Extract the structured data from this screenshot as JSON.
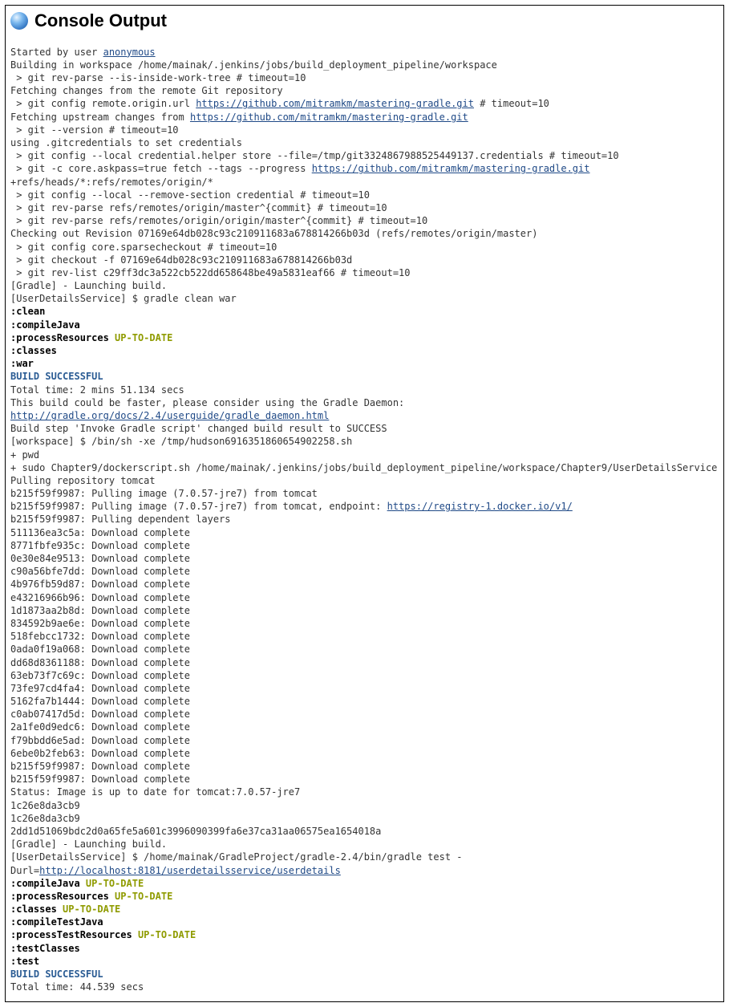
{
  "header": {
    "title": "Console Output"
  },
  "lines": [
    [
      {
        "t": "Started by user "
      },
      {
        "t": "anonymous",
        "link": true
      }
    ],
    [
      {
        "t": "Building in workspace /home/mainak/.jenkins/jobs/build_deployment_pipeline/workspace"
      }
    ],
    [
      {
        "t": " > git rev-parse --is-inside-work-tree # timeout=10"
      }
    ],
    [
      {
        "t": "Fetching changes from the remote Git repository"
      }
    ],
    [
      {
        "t": " > git config remote.origin.url "
      },
      {
        "t": "https://github.com/mitramkm/mastering-gradle.git",
        "link": true
      },
      {
        "t": " # timeout=10"
      }
    ],
    [
      {
        "t": "Fetching upstream changes from "
      },
      {
        "t": "https://github.com/mitramkm/mastering-gradle.git",
        "link": true
      }
    ],
    [
      {
        "t": " > git --version # timeout=10"
      }
    ],
    [
      {
        "t": "using .gitcredentials to set credentials"
      }
    ],
    [
      {
        "t": " > git config --local credential.helper store --file=/tmp/git3324867988525449137.credentials # timeout=10"
      }
    ],
    [
      {
        "t": " > git -c core.askpass=true fetch --tags --progress "
      },
      {
        "t": "https://github.com/mitramkm/mastering-gradle.git",
        "link": true
      },
      {
        "t": " +refs/heads/*:refs/remotes/origin/*"
      }
    ],
    [
      {
        "t": " > git config --local --remove-section credential # timeout=10"
      }
    ],
    [
      {
        "t": " > git rev-parse refs/remotes/origin/master^{commit} # timeout=10"
      }
    ],
    [
      {
        "t": " > git rev-parse refs/remotes/origin/origin/master^{commit} # timeout=10"
      }
    ],
    [
      {
        "t": "Checking out Revision 07169e64db028c93c210911683a678814266b03d (refs/remotes/origin/master)"
      }
    ],
    [
      {
        "t": " > git config core.sparsecheckout # timeout=10"
      }
    ],
    [
      {
        "t": " > git checkout -f 07169e64db028c93c210911683a678814266b03d"
      }
    ],
    [
      {
        "t": " > git rev-list c29ff3dc3a522cb522dd658648be49a5831eaf66 # timeout=10"
      }
    ],
    [
      {
        "t": "[Gradle] - Launching build."
      }
    ],
    [
      {
        "t": "[UserDetailsService] $ gradle clean war"
      }
    ],
    [
      {
        "t": ":clean",
        "cls": "bold"
      }
    ],
    [
      {
        "t": ":compileJava",
        "cls": "bold"
      }
    ],
    [
      {
        "t": ":processResources",
        "cls": "bold"
      },
      {
        "t": " UP-TO-DATE",
        "cls": "olive"
      }
    ],
    [
      {
        "t": ":classes",
        "cls": "bold"
      }
    ],
    [
      {
        "t": ":war",
        "cls": "bold"
      }
    ],
    [
      {
        "t": ""
      }
    ],
    [
      {
        "t": "BUILD SUCCESSFUL",
        "cls": "navy"
      }
    ],
    [
      {
        "t": ""
      }
    ],
    [
      {
        "t": "Total time: 2 mins 51.134 secs"
      }
    ],
    [
      {
        "t": ""
      }
    ],
    [
      {
        "t": "This build could be faster, please consider using the Gradle Daemon: "
      },
      {
        "t": "http://gradle.org/docs/2.4/userguide/gradle_daemon.html",
        "link": true
      }
    ],
    [
      {
        "t": "Build step 'Invoke Gradle script' changed build result to SUCCESS"
      }
    ],
    [
      {
        "t": "[workspace] $ /bin/sh -xe /tmp/hudson6916351860654902258.sh"
      }
    ],
    [
      {
        "t": "+ pwd"
      }
    ],
    [
      {
        "t": "+ sudo Chapter9/dockerscript.sh /home/mainak/.jenkins/jobs/build_deployment_pipeline/workspace/Chapter9/UserDetailsService"
      }
    ],
    [
      {
        "t": "Pulling repository tomcat"
      }
    ],
    [
      {
        "t": "b215f59f9987: Pulling image (7.0.57-jre7) from tomcat"
      }
    ],
    [
      {
        "t": "b215f59f9987: Pulling image (7.0.57-jre7) from tomcat, endpoint: "
      },
      {
        "t": "https://registry-1.docker.io/v1/",
        "link": true
      }
    ],
    [
      {
        "t": "b215f59f9987: Pulling dependent layers"
      }
    ],
    [
      {
        "t": "511136ea3c5a: Download complete"
      }
    ],
    [
      {
        "t": "8771fbfe935c: Download complete"
      }
    ],
    [
      {
        "t": "0e30e84e9513: Download complete"
      }
    ],
    [
      {
        "t": "c90a56bfe7dd: Download complete"
      }
    ],
    [
      {
        "t": "4b976fb59d87: Download complete"
      }
    ],
    [
      {
        "t": "e43216966b96: Download complete"
      }
    ],
    [
      {
        "t": "1d1873aa2b8d: Download complete"
      }
    ],
    [
      {
        "t": "834592b9ae6e: Download complete"
      }
    ],
    [
      {
        "t": "518febcc1732: Download complete"
      }
    ],
    [
      {
        "t": "0ada0f19a068: Download complete"
      }
    ],
    [
      {
        "t": "dd68d8361188: Download complete"
      }
    ],
    [
      {
        "t": "63eb73f7c69c: Download complete"
      }
    ],
    [
      {
        "t": "73fe97cd4fa4: Download complete"
      }
    ],
    [
      {
        "t": "5162fa7b1444: Download complete"
      }
    ],
    [
      {
        "t": "c0ab07417d5d: Download complete"
      }
    ],
    [
      {
        "t": "2a1fe0d9edc6: Download complete"
      }
    ],
    [
      {
        "t": "f79bbdd6e5ad: Download complete"
      }
    ],
    [
      {
        "t": "6ebe0b2feb63: Download complete"
      }
    ],
    [
      {
        "t": "b215f59f9987: Download complete"
      }
    ],
    [
      {
        "t": "b215f59f9987: Download complete"
      }
    ],
    [
      {
        "t": "Status: Image is up to date for tomcat:7.0.57-jre7"
      }
    ],
    [
      {
        "t": "1c26e8da3cb9"
      }
    ],
    [
      {
        "t": "1c26e8da3cb9"
      }
    ],
    [
      {
        "t": "2dd1d51069bdc2d0a65fe5a601c3996090399fa6e37ca31aa06575ea1654018a"
      }
    ],
    [
      {
        "t": "[Gradle] - Launching build."
      }
    ],
    [
      {
        "t": "[UserDetailsService] $ /home/mainak/GradleProject/gradle-2.4/bin/gradle test -Durl="
      },
      {
        "t": "http://localhost:8181/userdetailsservice/userdetails",
        "link": true
      }
    ],
    [
      {
        "t": ":compileJava",
        "cls": "bold"
      },
      {
        "t": " UP-TO-DATE",
        "cls": "olive"
      }
    ],
    [
      {
        "t": ":processResources",
        "cls": "bold"
      },
      {
        "t": " UP-TO-DATE",
        "cls": "olive"
      }
    ],
    [
      {
        "t": ":classes",
        "cls": "bold"
      },
      {
        "t": " UP-TO-DATE",
        "cls": "olive"
      }
    ],
    [
      {
        "t": ":compileTestJava",
        "cls": "bold"
      }
    ],
    [
      {
        "t": ":processTestResources",
        "cls": "bold"
      },
      {
        "t": " UP-TO-DATE",
        "cls": "olive"
      }
    ],
    [
      {
        "t": ":testClasses",
        "cls": "bold"
      }
    ],
    [
      {
        "t": ":test",
        "cls": "bold"
      }
    ],
    [
      {
        "t": ""
      }
    ],
    [
      {
        "t": "BUILD SUCCESSFUL",
        "cls": "navy"
      }
    ],
    [
      {
        "t": ""
      }
    ],
    [
      {
        "t": "Total time: 44.539 secs"
      }
    ]
  ]
}
